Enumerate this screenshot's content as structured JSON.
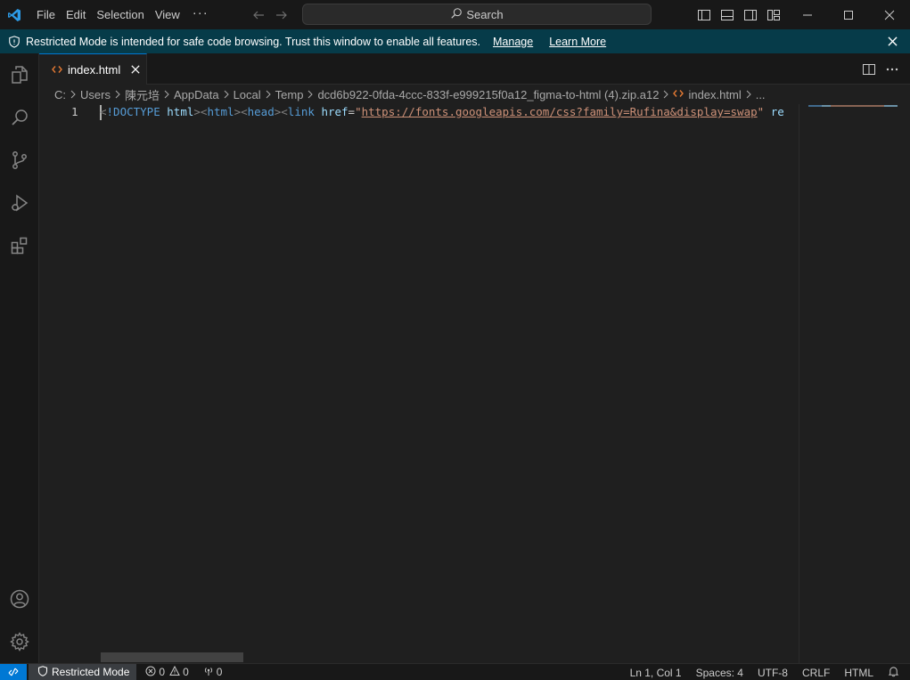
{
  "menu": [
    "File",
    "Edit",
    "Selection",
    "View"
  ],
  "search": {
    "label": "Search"
  },
  "banner": {
    "message": "Restricted Mode is intended for safe code browsing. Trust this window to enable all features.",
    "manage": "Manage",
    "learn_more": "Learn More"
  },
  "tab": {
    "label": "index.html"
  },
  "breadcrumb": [
    "C:",
    "Users",
    "陳元培",
    "AppData",
    "Local",
    "Temp",
    "dcd6b922-0fda-4ccc-833f-e999215f0a12_figma-to-html (4).zip.a12",
    "index.html",
    "..."
  ],
  "editor": {
    "line_number": "1",
    "code": {
      "lt1": "<",
      "doctype": "!DOCTYPE",
      "html_kw": "html",
      "gt1": ">",
      "lt2": "<",
      "tag_html": "html",
      "gt2": ">",
      "lt3": "<",
      "tag_head": "head",
      "gt3": ">",
      "lt4": "<",
      "tag_link": "link",
      "attr_href": "href",
      "eq": "=",
      "quote1": "\"",
      "url": "https://fonts.googleapis.com/css?family=Rufina&display=swap",
      "quote2": "\"",
      "rest": "re"
    }
  },
  "status": {
    "restricted": "Restricted Mode",
    "errors": "0",
    "warnings": "0",
    "ports": "0",
    "position": "Ln 1, Col 1",
    "spaces": "Spaces: 4",
    "encoding": "UTF-8",
    "eol": "CRLF",
    "language": "HTML"
  },
  "colors": {
    "accent": "#0078d4",
    "banner_bg": "#063b49",
    "editor_bg": "#1f1f1f",
    "chrome_bg": "#181818"
  }
}
